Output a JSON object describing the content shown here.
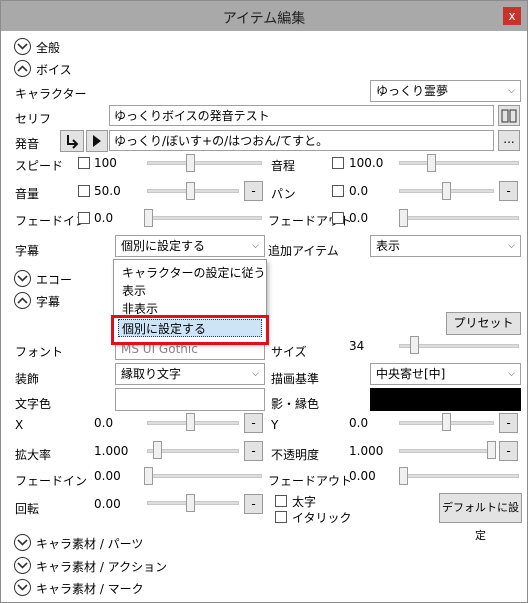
{
  "window": {
    "title": "アイテム編集",
    "close_glyph": "x"
  },
  "sections": {
    "general": "全般",
    "voice": "ボイス",
    "echo": "エコー",
    "subtitle": "字幕",
    "parts": "キャラ素材 / パーツ",
    "action": "キャラ素材 / アクション",
    "mark": "キャラ素材 / マーク"
  },
  "voice": {
    "character_label": "キャラクター",
    "character_value": "ゆっくり霊夢",
    "serif_label": "セリフ",
    "serif_value": "ゆっくりボイスの発音テスト",
    "pron_label": "発音",
    "pron_value": "ゆっくり/ぼいす+の/はつおん/てすと。",
    "ellipsis": "...",
    "speed_label": "スピード",
    "speed_value": "100",
    "pitch_label": "音程",
    "pitch_value": "100.0",
    "volume_label": "音量",
    "volume_value": "50.0",
    "pan_label": "パン",
    "pan_value": "0.0",
    "fadein_label": "フェードイン",
    "fadein_value": "0.0",
    "fadeout_label": "フェードアウト",
    "fadeout_value": "0.0",
    "subtitle_label": "字幕",
    "subtitle_value": "個別に設定する",
    "additem_label": "追加アイテム",
    "additem_value": "表示",
    "minus": "-"
  },
  "popup": {
    "options": [
      "キャラクターの設定に従う",
      "表示",
      "非表示",
      "個別に設定する"
    ],
    "selected_index": 3
  },
  "subtitle": {
    "preset_button": "プリセット",
    "font_label": "フォント",
    "font_value": "MS UI Gothic",
    "size_label": "サイズ",
    "size_value": "34",
    "decor_label": "装飾",
    "decor_value": "縁取り文字",
    "anchor_label": "描画基準",
    "anchor_value": "中央寄せ[中]",
    "color_label": "文字色",
    "shadow_label": "影・縁色",
    "x_label": "X",
    "x_value": "0.0",
    "y_label": "Y",
    "y_value": "0.0",
    "scale_label": "拡大率",
    "scale_value": "1.000",
    "opacity_label": "不透明度",
    "opacity_value": "1.000",
    "fadein_label": "フェードイン",
    "fadein_value": "0.00",
    "fadeout_label": "フェードアウト",
    "fadeout_value": "0.00",
    "rotate_label": "回転",
    "rotate_value": "0.00",
    "bold_label": "太字",
    "italic_label": "イタリック",
    "default_button": "デフォルトに設定",
    "minus": "-",
    "shadow_color": "#000000"
  }
}
